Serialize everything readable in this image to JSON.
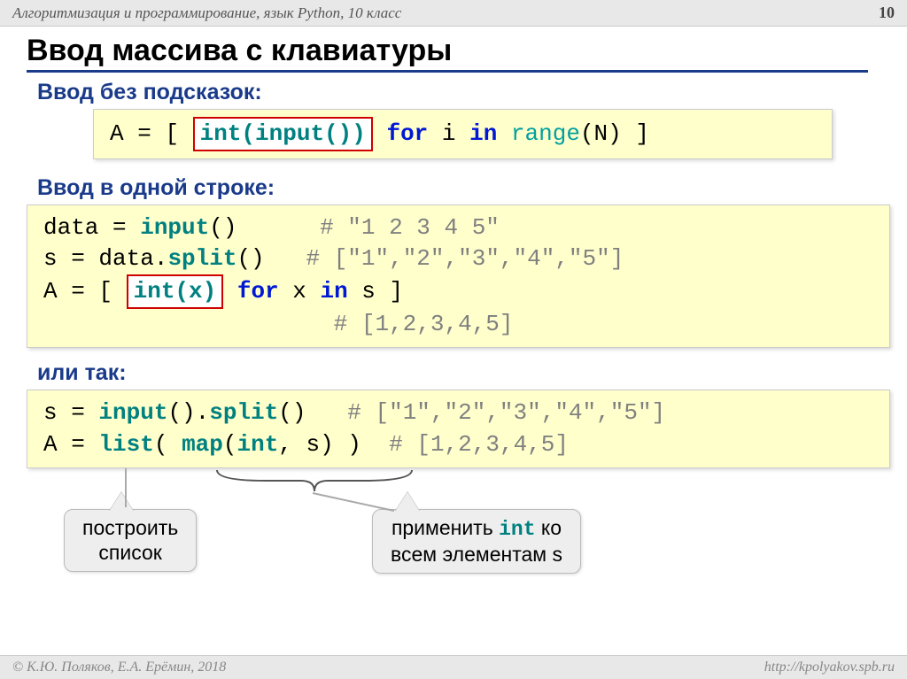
{
  "header": {
    "label": "Алгоритмизация и программирование, язык Python, 10 класс",
    "page_num": "10"
  },
  "title": "Ввод массива с клавиатуры",
  "section1_label": "Ввод без подсказок:",
  "code1": {
    "p1": "A = [ ",
    "highlight": "int(input())",
    "p2": " for i in range(N) ]",
    "kw_for": "for",
    "kw_in": "in",
    "fn_range": "range",
    "plain_i": " i ",
    "plain_n": "(N) ]"
  },
  "section2_label": "Ввод в одной строке:",
  "code2": {
    "l1_a": "data = ",
    "l1_fn": "input",
    "l1_b": "()",
    "l1_comment": "# \"1 2 3 4 5\"",
    "l2_a": "s = data.",
    "l2_fn": "split",
    "l2_b": "()",
    "l2_comment": "# [\"1\",\"2\",\"3\",\"4\",\"5\"]",
    "l3_a": "A = [ ",
    "l3_highlight": "int(x)",
    "l3_for": "for",
    "l3_mid": " x ",
    "l3_in": "in",
    "l3_end": " s ]",
    "l4_comment": "# [1,2,3,4,5]"
  },
  "section3_label": "или так:",
  "code3": {
    "l1_a": "s = ",
    "l1_fn1": "input",
    "l1_b": "().",
    "l1_fn2": "split",
    "l1_c": "()",
    "l1_comment": "# [\"1\",\"2\",\"3\",\"4\",\"5\"]",
    "l2_a": "A = ",
    "l2_list": "list",
    "l2_b": "( ",
    "l2_map": "map",
    "l2_c": "(",
    "l2_int": "int",
    "l2_d": ", s) )",
    "l2_comment": "# [1,2,3,4,5]"
  },
  "callouts": {
    "left_l1": "построить",
    "left_l2": "список",
    "right_pre": "применить ",
    "right_code": "int",
    "right_post": " ко",
    "right_l2": "всем элементам s"
  },
  "footer": {
    "left": "© К.Ю. Поляков, Е.А. Ерёмин, 2018",
    "right": "http://kpolyakov.spb.ru"
  }
}
